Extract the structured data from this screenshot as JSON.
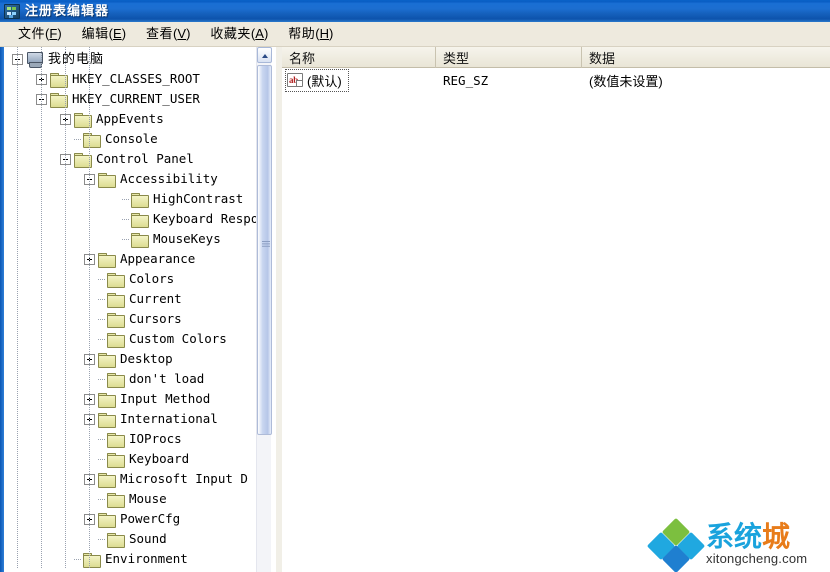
{
  "window": {
    "title": "注册表编辑器",
    "icon": "registry-editor-icon"
  },
  "menubar": {
    "items": [
      {
        "name": "文件",
        "key": "F"
      },
      {
        "name": "编辑",
        "key": "E"
      },
      {
        "name": "查看",
        "key": "V"
      },
      {
        "name": "收藏夹",
        "key": "A"
      },
      {
        "name": "帮助",
        "key": "H"
      }
    ]
  },
  "tree": {
    "nodes": [
      {
        "label": "我的电脑",
        "depth": 0,
        "expander": "minus",
        "icon": "computer-icon",
        "cjk": true
      },
      {
        "label": "HKEY_CLASSES_ROOT",
        "depth": 1,
        "expander": "plus",
        "icon": "folder-icon",
        "cjk": false
      },
      {
        "label": "HKEY_CURRENT_USER",
        "depth": 1,
        "expander": "minus",
        "icon": "folder-icon",
        "cjk": false
      },
      {
        "label": "AppEvents",
        "depth": 2,
        "expander": "plus",
        "icon": "folder-icon",
        "cjk": false
      },
      {
        "label": "Console",
        "depth": 2,
        "expander": "none",
        "icon": "folder-icon",
        "cjk": false
      },
      {
        "label": "Control Panel",
        "depth": 2,
        "expander": "minus",
        "icon": "folder-icon",
        "cjk": false
      },
      {
        "label": "Accessibility",
        "depth": 3,
        "expander": "minus",
        "icon": "folder-icon",
        "cjk": false
      },
      {
        "label": "HighContrast",
        "depth": 4,
        "expander": "none",
        "icon": "folder-icon",
        "cjk": false
      },
      {
        "label": "Keyboard Respo",
        "depth": 4,
        "expander": "none",
        "icon": "folder-icon",
        "cjk": false
      },
      {
        "label": "MouseKeys",
        "depth": 4,
        "expander": "none",
        "icon": "folder-icon",
        "cjk": false
      },
      {
        "label": "Appearance",
        "depth": 3,
        "expander": "plus",
        "icon": "folder-icon",
        "cjk": false
      },
      {
        "label": "Colors",
        "depth": 3,
        "expander": "none",
        "icon": "folder-icon",
        "cjk": false
      },
      {
        "label": "Current",
        "depth": 3,
        "expander": "none",
        "icon": "folder-icon",
        "cjk": false
      },
      {
        "label": "Cursors",
        "depth": 3,
        "expander": "none",
        "icon": "folder-icon",
        "cjk": false
      },
      {
        "label": "Custom Colors",
        "depth": 3,
        "expander": "none",
        "icon": "folder-icon",
        "cjk": false
      },
      {
        "label": "Desktop",
        "depth": 3,
        "expander": "plus",
        "icon": "folder-icon",
        "cjk": false
      },
      {
        "label": "don't load",
        "depth": 3,
        "expander": "none",
        "icon": "folder-icon",
        "cjk": false
      },
      {
        "label": "Input Method",
        "depth": 3,
        "expander": "plus",
        "icon": "folder-icon",
        "cjk": false
      },
      {
        "label": "International",
        "depth": 3,
        "expander": "plus",
        "icon": "folder-icon",
        "cjk": false
      },
      {
        "label": "IOProcs",
        "depth": 3,
        "expander": "none",
        "icon": "folder-icon",
        "cjk": false
      },
      {
        "label": "Keyboard",
        "depth": 3,
        "expander": "none",
        "icon": "folder-icon",
        "cjk": false
      },
      {
        "label": "Microsoft Input D",
        "depth": 3,
        "expander": "plus",
        "icon": "folder-icon",
        "cjk": false
      },
      {
        "label": "Mouse",
        "depth": 3,
        "expander": "none",
        "icon": "folder-icon",
        "cjk": false
      },
      {
        "label": "PowerCfg",
        "depth": 3,
        "expander": "plus",
        "icon": "folder-icon",
        "cjk": false
      },
      {
        "label": "Sound",
        "depth": 3,
        "expander": "none",
        "icon": "folder-icon",
        "cjk": false
      },
      {
        "label": "Environment",
        "depth": 2,
        "expander": "none",
        "icon": "folder-icon",
        "cjk": false
      }
    ],
    "scrollbar": {
      "up_arrow": "scroll-up-arrow"
    }
  },
  "list": {
    "columns": [
      "名称",
      "类型",
      "数据"
    ],
    "rows": [
      {
        "name": "(默认)",
        "type": "REG_SZ",
        "data": "(数值未设置)",
        "icon": "string-value-icon",
        "selected": true
      }
    ]
  },
  "watermark": {
    "cn_part1": "系",
    "cn_part2": "统",
    "cn_part3": "城",
    "domain": "xitongcheng.com"
  }
}
